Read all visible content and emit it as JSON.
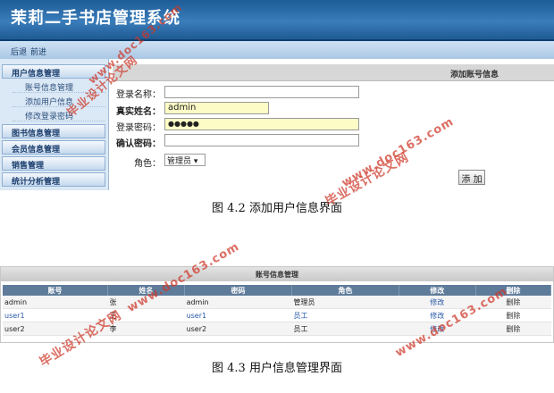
{
  "header": {
    "title": "茉莉二手书店管理系统"
  },
  "navbar": {
    "back": "后退",
    "forward": "前进"
  },
  "sidebar": {
    "sections": [
      {
        "label": "用户信息管理",
        "items": [
          "账号信息管理",
          "添加用户信息",
          "修改登录密码"
        ]
      },
      {
        "label": "图书信息管理"
      },
      {
        "label": "会员信息管理"
      },
      {
        "label": "销售管理"
      },
      {
        "label": "统计分析管理"
      }
    ]
  },
  "form": {
    "title": "添加账号信息",
    "login_name_label": "登录名称：",
    "login_name_value": "",
    "real_name_label": "真实姓名：",
    "real_name_value": "admin",
    "password_label": "登录密码：",
    "password_value": "●●●●●",
    "confirm_label": "确认密码：",
    "confirm_value": "",
    "role_label": "角色：",
    "role_value": "管理员 ▾",
    "submit_label": "添 加"
  },
  "captions": {
    "fig1": "图 4.2  添加用户信息界面",
    "fig2": "图 4.3  用户信息管理界面"
  },
  "table": {
    "title": "账号信息管理",
    "columns": [
      "账号",
      "姓名",
      "密码",
      "角色",
      "修改",
      "删除"
    ],
    "rows": [
      {
        "account": "admin",
        "name": "张",
        "password": "admin",
        "role": "管理员",
        "edit": "修改",
        "delete": "删除"
      },
      {
        "account": "user1",
        "name": "王",
        "password": "user1",
        "role": "员工",
        "edit": "修改",
        "delete": "删除"
      },
      {
        "account": "user2",
        "name": "李",
        "password": "user2",
        "role": "员工",
        "edit": "修改",
        "delete": "删除"
      }
    ]
  },
  "watermarks": {
    "site": "www.doc163.com",
    "brand": "毕业设计论文网"
  },
  "colors": {
    "header": "#2a6aa8",
    "table_header": "#5e7b9a",
    "watermark": "#cd3728"
  }
}
